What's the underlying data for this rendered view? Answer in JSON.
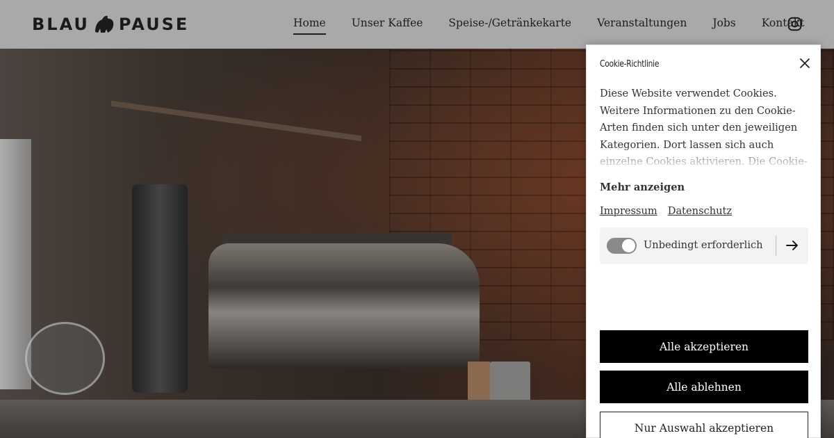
{
  "header": {
    "logo_left": "BLAU",
    "logo_right": "PAUSE",
    "nav": [
      {
        "label": "Home",
        "active": true
      },
      {
        "label": "Unser Kaffee",
        "active": false
      },
      {
        "label": "Speise-/Getränkekarte",
        "active": false
      },
      {
        "label": "Veranstaltungen",
        "active": false
      },
      {
        "label": "Jobs",
        "active": false
      },
      {
        "label": "Kontakt",
        "active": false
      }
    ],
    "social_icon": "instagram-icon"
  },
  "cookie": {
    "title": "Cookie-Richtlinie",
    "text": "Diese Website verwendet Cookies. Weitere Informationen zu den Cookie-Arten finden sich unter den jeweiligen Kategorien. Dort lassen sich auch einzelne Cookies aktivieren. Die Cookie-Einstellungen können jederzeit",
    "more_label": "Mehr anzeigen",
    "links": [
      "Impressum",
      "Datenschutz"
    ],
    "category": {
      "label": "Unbedingt erforderlich",
      "enabled": true
    },
    "buttons": {
      "accept_all": "Alle akzeptieren",
      "reject_all": "Alle ablehnen",
      "accept_selection": "Nur Auswahl akzeptieren"
    }
  },
  "colors": {
    "header_bg": "#a9a9a9",
    "primary_button": "#000000",
    "panel_bg": "#ffffff"
  }
}
